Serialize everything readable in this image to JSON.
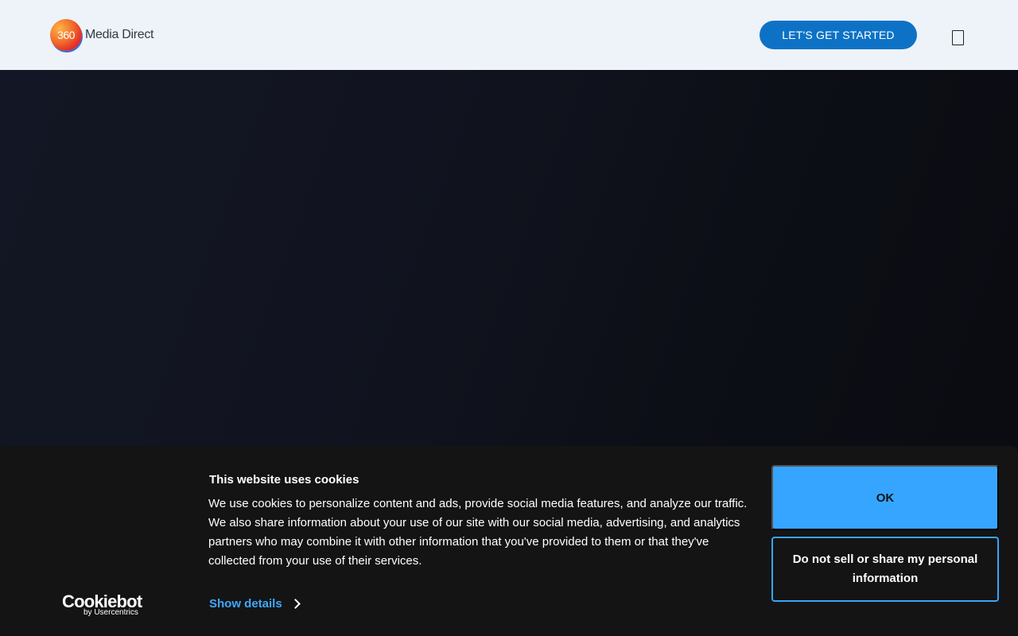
{
  "header": {
    "logo_number": "360",
    "logo_text": "Media Direct",
    "cta_label": "LET'S GET STARTED",
    "menu_icon": "menu-icon"
  },
  "cookie_banner": {
    "brand": "Cookiebot",
    "brand_sub": "by Usercentrics",
    "title": "This website uses cookies",
    "body": "We use cookies to personalize content and ads, provide social media features, and analyze our traffic. We also share information about your use of our site with our social media, advertising, and analytics partners who may combine it with other information that you've provided to them or that they've collected from your use of their services.",
    "show_details_label": "Show details",
    "ok_label": "OK",
    "do_not_sell_label": "Do not sell or share my personal information"
  },
  "colors": {
    "accent": "#36a5ff",
    "cta": "#0d72c6",
    "header_bg": "#eef3f9",
    "banner_bg": "#141414"
  }
}
